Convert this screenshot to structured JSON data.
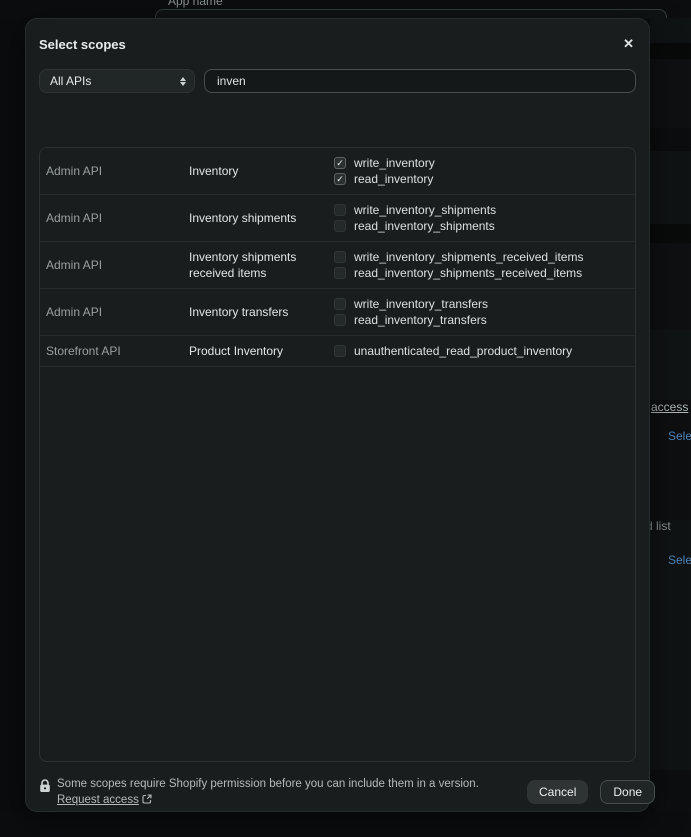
{
  "background": {
    "app_name_label": "App name",
    "partial_texts": {
      "access_link": "access",
      "select_link_1": "Select",
      "saved_list": "d list",
      "select_link_2": "Select"
    }
  },
  "modal": {
    "title": "Select scopes",
    "close_icon": "✕",
    "api_filter": {
      "value": "All APIs"
    },
    "search": {
      "value": "inven"
    },
    "rows": [
      {
        "api": "Admin API",
        "category": "Inventory",
        "scopes": [
          {
            "name": "write_inventory",
            "checked": true
          },
          {
            "name": "read_inventory",
            "checked": true
          }
        ]
      },
      {
        "api": "Admin API",
        "category": "Inventory shipments",
        "scopes": [
          {
            "name": "write_inventory_shipments",
            "checked": false
          },
          {
            "name": "read_inventory_shipments",
            "checked": false
          }
        ]
      },
      {
        "api": "Admin API",
        "category": "Inventory shipments received items",
        "scopes": [
          {
            "name": "write_inventory_shipments_received_items",
            "checked": false
          },
          {
            "name": "read_inventory_shipments_received_items",
            "checked": false
          }
        ]
      },
      {
        "api": "Admin API",
        "category": "Inventory transfers",
        "scopes": [
          {
            "name": "write_inventory_transfers",
            "checked": false
          },
          {
            "name": "read_inventory_transfers",
            "checked": false
          }
        ]
      },
      {
        "api": "Storefront API",
        "category": "Product Inventory",
        "scopes": [
          {
            "name": "unauthenticated_read_product_inventory",
            "checked": false
          }
        ]
      }
    ],
    "footer": {
      "note": "Some scopes require Shopify permission before you can include them in a version.",
      "link_label": "Request access",
      "cancel_label": "Cancel",
      "done_label": "Done"
    }
  },
  "colors": {
    "modal_bg": "#191d1e",
    "page_bg": "#0a0c0d",
    "border": "#2b3232",
    "text_primary": "#e8ebeb",
    "text_secondary": "#98a0a0",
    "link_blue": "#4f86ba"
  }
}
